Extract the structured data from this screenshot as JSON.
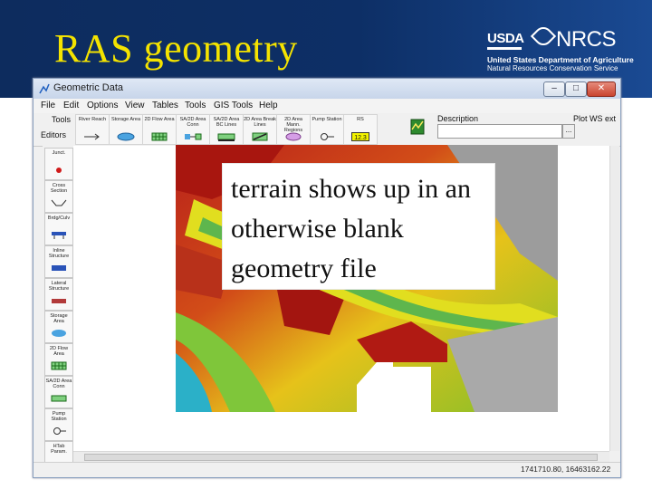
{
  "slide": {
    "title": "RAS geometry",
    "agency": {
      "usda": "USDA",
      "nrcs": "NRCS",
      "line1": "United States Department of Agriculture",
      "line2": "Natural Resources Conservation Service"
    }
  },
  "window": {
    "title": "Geometric Data",
    "controls": {
      "minimize": "–",
      "maximize": "□",
      "close": "✕"
    }
  },
  "menu": [
    "File",
    "Edit",
    "Options",
    "View",
    "Tables",
    "Tools",
    "GIS Tools",
    "Help"
  ],
  "toolbar": {
    "tools_label": "Tools",
    "editors_label": "Editors",
    "buttons": [
      "River Reach",
      "Storage Area",
      "2D Flow Area",
      "SA/2D Area Conn",
      "SA/2D Area BC Lines",
      "2D Area Break Lines",
      "2D Area Mann. Regions",
      "Pump Station",
      "RS"
    ],
    "rs_value": "12.3",
    "description_label": "Description",
    "description_value": "",
    "description_more": "...",
    "plot_label": "Plot WS ext"
  },
  "editors": [
    "Junct.",
    "Cross Section",
    "Brdg/Culv",
    "Inline Structure",
    "Lateral Structure",
    "Storage Area",
    "2D Flow Area",
    "SA/2D Area Conn",
    "Pump Station",
    "HTab Param."
  ],
  "status": {
    "coordinates": "1741710.80, 16463162.22"
  },
  "callout": {
    "text": "terrain shows up in an otherwise blank geometry file"
  },
  "colors": {
    "header_bg": "#0d2c5e",
    "title": "#f4e300",
    "terrain_low": "#2bb0c8",
    "terrain_mid": "#e6e01a",
    "terrain_high": "#c01a12"
  }
}
